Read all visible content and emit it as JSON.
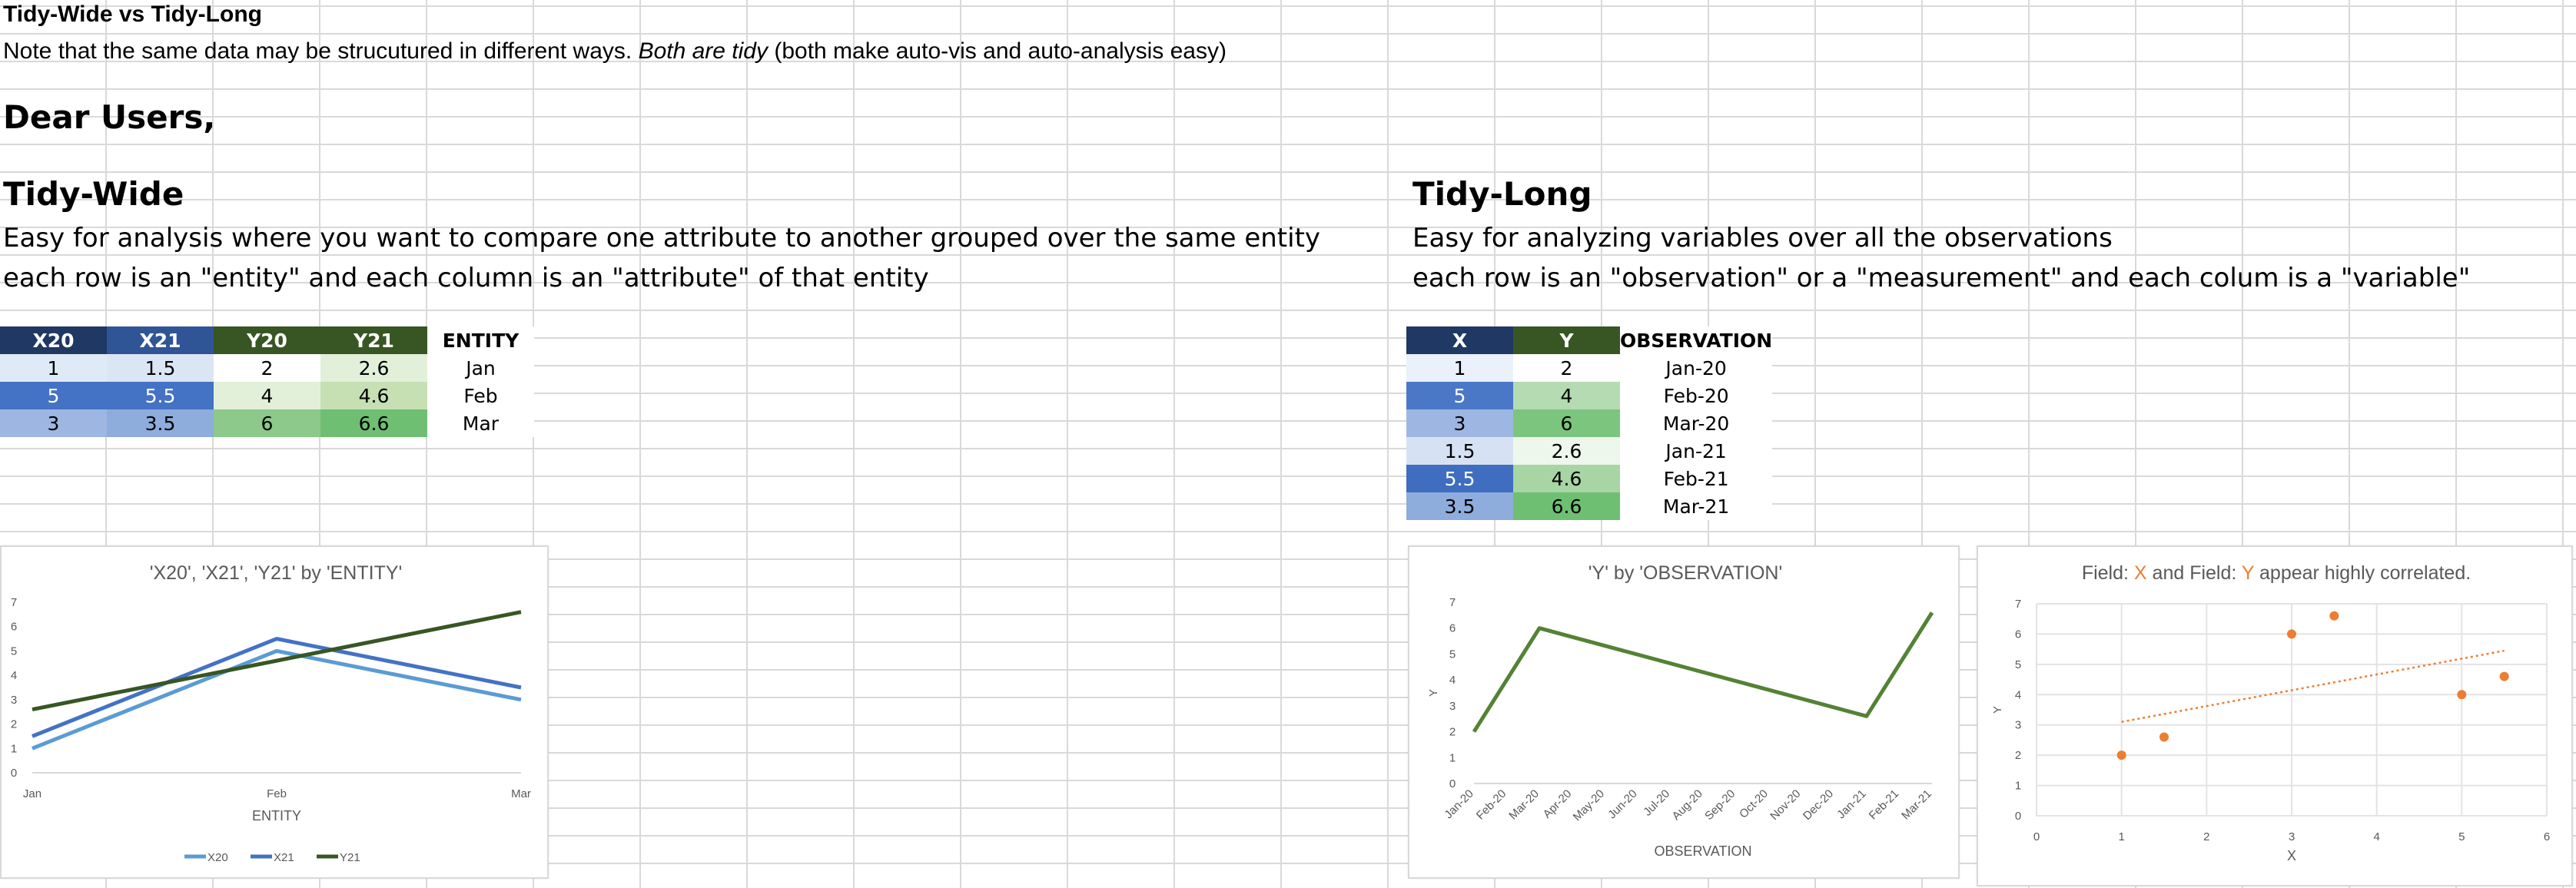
{
  "header": {
    "title": "Tidy-Wide vs Tidy-Long",
    "note_prefix": "Note that the same data may be strucutured in different ways.",
    "note_italic": "Both are tidy",
    "note_suffix": "(both make auto-vis and auto-analysis easy)",
    "greeting": "Dear Users,"
  },
  "wide": {
    "heading": "Tidy-Wide",
    "desc1": "Easy for analysis where you want to compare one attribute to another grouped over the same entity",
    "desc2": "each row is an \"entity\" and each column is an \"attribute\" of that entity",
    "columns": [
      "X20",
      "X21",
      "Y20",
      "Y21",
      "ENTITY"
    ],
    "rows": [
      [
        "1",
        "1.5",
        "2",
        "2.6",
        "Jan"
      ],
      [
        "5",
        "5.5",
        "4",
        "4.6",
        "Feb"
      ],
      [
        "3",
        "3.5",
        "6",
        "6.6",
        "Mar"
      ]
    ]
  },
  "long": {
    "heading": "Tidy-Long",
    "desc1": "Easy for analyzing variables over all the observations",
    "desc2": "each row is an \"observation\" or a \"measurement\" and each colum is a \"variable\"",
    "columns": [
      "X",
      "Y",
      "OBSERVATION"
    ],
    "rows": [
      [
        "1",
        "2",
        "Jan-20"
      ],
      [
        "5",
        "4",
        "Feb-20"
      ],
      [
        "3",
        "6",
        "Mar-20"
      ],
      [
        "1.5",
        "2.6",
        "Jan-21"
      ],
      [
        "5.5",
        "4.6",
        "Feb-21"
      ],
      [
        "3.5",
        "6.6",
        "Mar-21"
      ]
    ]
  },
  "colors": {
    "blue_header": "#1f3864",
    "green_header": "#375623",
    "series_x20": "#5b9bd5",
    "series_x21": "#4472c4",
    "series_y21": "#375623",
    "series_y_obs": "#548235",
    "scatter_point": "#ed7d31"
  },
  "chart_data": [
    {
      "type": "line",
      "title": "'X20', 'X21', 'Y21' by 'ENTITY'",
      "categories": [
        "Jan",
        "Feb",
        "Mar"
      ],
      "series": [
        {
          "name": "X20",
          "values": [
            1,
            5,
            3
          ]
        },
        {
          "name": "X21",
          "values": [
            1.5,
            5.5,
            3.5
          ]
        },
        {
          "name": "Y21",
          "values": [
            2.6,
            4.6,
            6.6
          ]
        }
      ],
      "xlabel": "ENTITY",
      "ylabel": "",
      "ylim": [
        0,
        7
      ],
      "yticks": [
        "0",
        "1",
        "2",
        "3",
        "4",
        "5",
        "6",
        "7"
      ],
      "legend": "bottom",
      "grid": false
    },
    {
      "type": "line",
      "title": "'Y' by 'OBSERVATION'",
      "categories": [
        "Jan-20",
        "Feb-20",
        "Mar-20",
        "Apr-20",
        "May-20",
        "Jun-20",
        "Jul-20",
        "Aug-20",
        "Sep-20",
        "Oct-20",
        "Nov-20",
        "Dec-20",
        "Jan-21",
        "Feb-21",
        "Mar-21"
      ],
      "points": [
        {
          "x": "Jan-20",
          "y": 2
        },
        {
          "x": "Mar-20",
          "y": 6
        },
        {
          "x": "Jan-21",
          "y": 2.6
        },
        {
          "x": "Mar-21",
          "y": 6.6
        }
      ],
      "xlabel": "OBSERVATION",
      "ylabel": "Y",
      "ylim": [
        0,
        7
      ],
      "yticks": [
        "0",
        "1",
        "2",
        "3",
        "4",
        "5",
        "6",
        "7"
      ],
      "grid": false
    },
    {
      "type": "scatter",
      "title_parts": [
        "Field: ",
        "X",
        " and Field: ",
        "Y",
        " appear highly correlated."
      ],
      "x": [
        1,
        1.5,
        3,
        3.5,
        5,
        5.5
      ],
      "y": [
        2,
        2.6,
        6,
        6.6,
        4,
        4.6
      ],
      "trendline": {
        "from": [
          1,
          3.1
        ],
        "to": [
          5.5,
          5.45
        ]
      },
      "xlabel": "X",
      "ylabel": "Y",
      "xlim": [
        0,
        6
      ],
      "xticks": [
        "0",
        "1",
        "2",
        "3",
        "4",
        "5",
        "6"
      ],
      "ylim": [
        0,
        7
      ],
      "yticks": [
        "0",
        "1",
        "2",
        "3",
        "4",
        "5",
        "6",
        "7"
      ],
      "grid": true
    }
  ]
}
